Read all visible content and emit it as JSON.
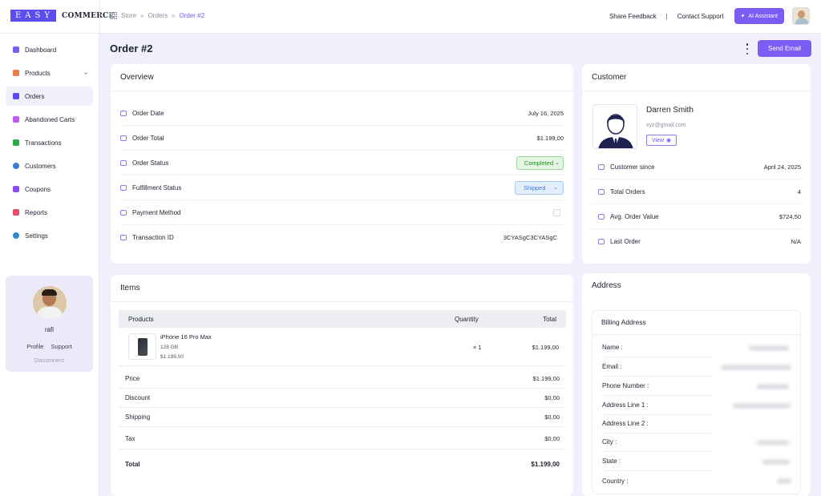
{
  "brand": {
    "logo_box": "EASY",
    "logo_text": "COMMERCE",
    "accent": "#7b5cf5"
  },
  "breadcrumb": [
    "Store",
    "Orders",
    "Order #2"
  ],
  "topbar": {
    "share_feedback": "Share Feedback",
    "separator": "|",
    "contact_support": "Contact Support",
    "ai_assistant": "AI Assistant"
  },
  "sidebar": {
    "items": [
      {
        "label": "Dashboard",
        "icon": "dashboard-icon",
        "color": "#7b5cf5"
      },
      {
        "label": "Products",
        "icon": "products-icon",
        "color": "#f07a4a"
      },
      {
        "label": "Orders",
        "icon": "orders-icon",
        "color": "#5b4df0"
      },
      {
        "label": "Abandoned Carts",
        "icon": "cart-icon",
        "color": "#c05cf5"
      },
      {
        "label": "Transactions",
        "icon": "transactions-icon",
        "color": "#2aa84a"
      },
      {
        "label": "Customers",
        "icon": "customers-icon",
        "color": "#3a7bd5"
      },
      {
        "label": "Coupons",
        "icon": "coupons-icon",
        "color": "#8a4df0"
      },
      {
        "label": "Reports",
        "icon": "reports-icon",
        "color": "#e84a6a"
      },
      {
        "label": "Settings",
        "icon": "settings-icon",
        "color": "#2a8ad5"
      }
    ]
  },
  "profile": {
    "name": "rafi",
    "profile_link": "Profile",
    "support_link": "Support",
    "disconnect": "Disconnect"
  },
  "page": {
    "title": "Order #2",
    "send_email": "Send Email"
  },
  "overview": {
    "title": "Overview",
    "order_date_label": "Order Date",
    "order_date": "July 16, 2025",
    "order_total_label": "Order Total",
    "order_total": "$1.199,00",
    "order_status_label": "Order Status",
    "order_status": "Completed",
    "fulfillment_label": "Fulfillment Status",
    "fulfillment": "Shipped",
    "payment_label": "Payment Method",
    "transaction_label": "Transaction ID",
    "transaction_id": "3CYASgC3CYASgC"
  },
  "items": {
    "title": "Items",
    "col_products": "Products",
    "col_quantity": "Quantity",
    "col_total": "Total",
    "product": {
      "name": "iPhone 16 Pro Max",
      "storage": "128 GB",
      "price": "$1.199,00",
      "qty": "× 1",
      "total": "$1.199,00"
    },
    "summary": [
      {
        "label": "Price",
        "value": "$1.199,00"
      },
      {
        "label": "Discount",
        "value": "$0,00"
      },
      {
        "label": "Shipping",
        "value": "$0,00"
      },
      {
        "label": "Tax",
        "value": "$0,00"
      },
      {
        "label": "Total",
        "value": "$1.199,00"
      }
    ]
  },
  "customer": {
    "title": "Customer",
    "name": "Darren Smith",
    "email": "xyz@gmail.com",
    "view": "View",
    "since_label": "Customer since",
    "since": "April 24, 2025",
    "orders_label": "Total Orders",
    "orders": "4",
    "avg_label": "Avg. Order Value",
    "avg": "$724,50",
    "last_label": "Last Order",
    "last": "N/A"
  },
  "address": {
    "title": "Address",
    "billing_title": "Billing Address",
    "fields": [
      "Name :",
      "Email :",
      "Phone Number :",
      "Address Line 1 :",
      "Address Line 2 :",
      "City :",
      "State :",
      "Country :"
    ]
  }
}
